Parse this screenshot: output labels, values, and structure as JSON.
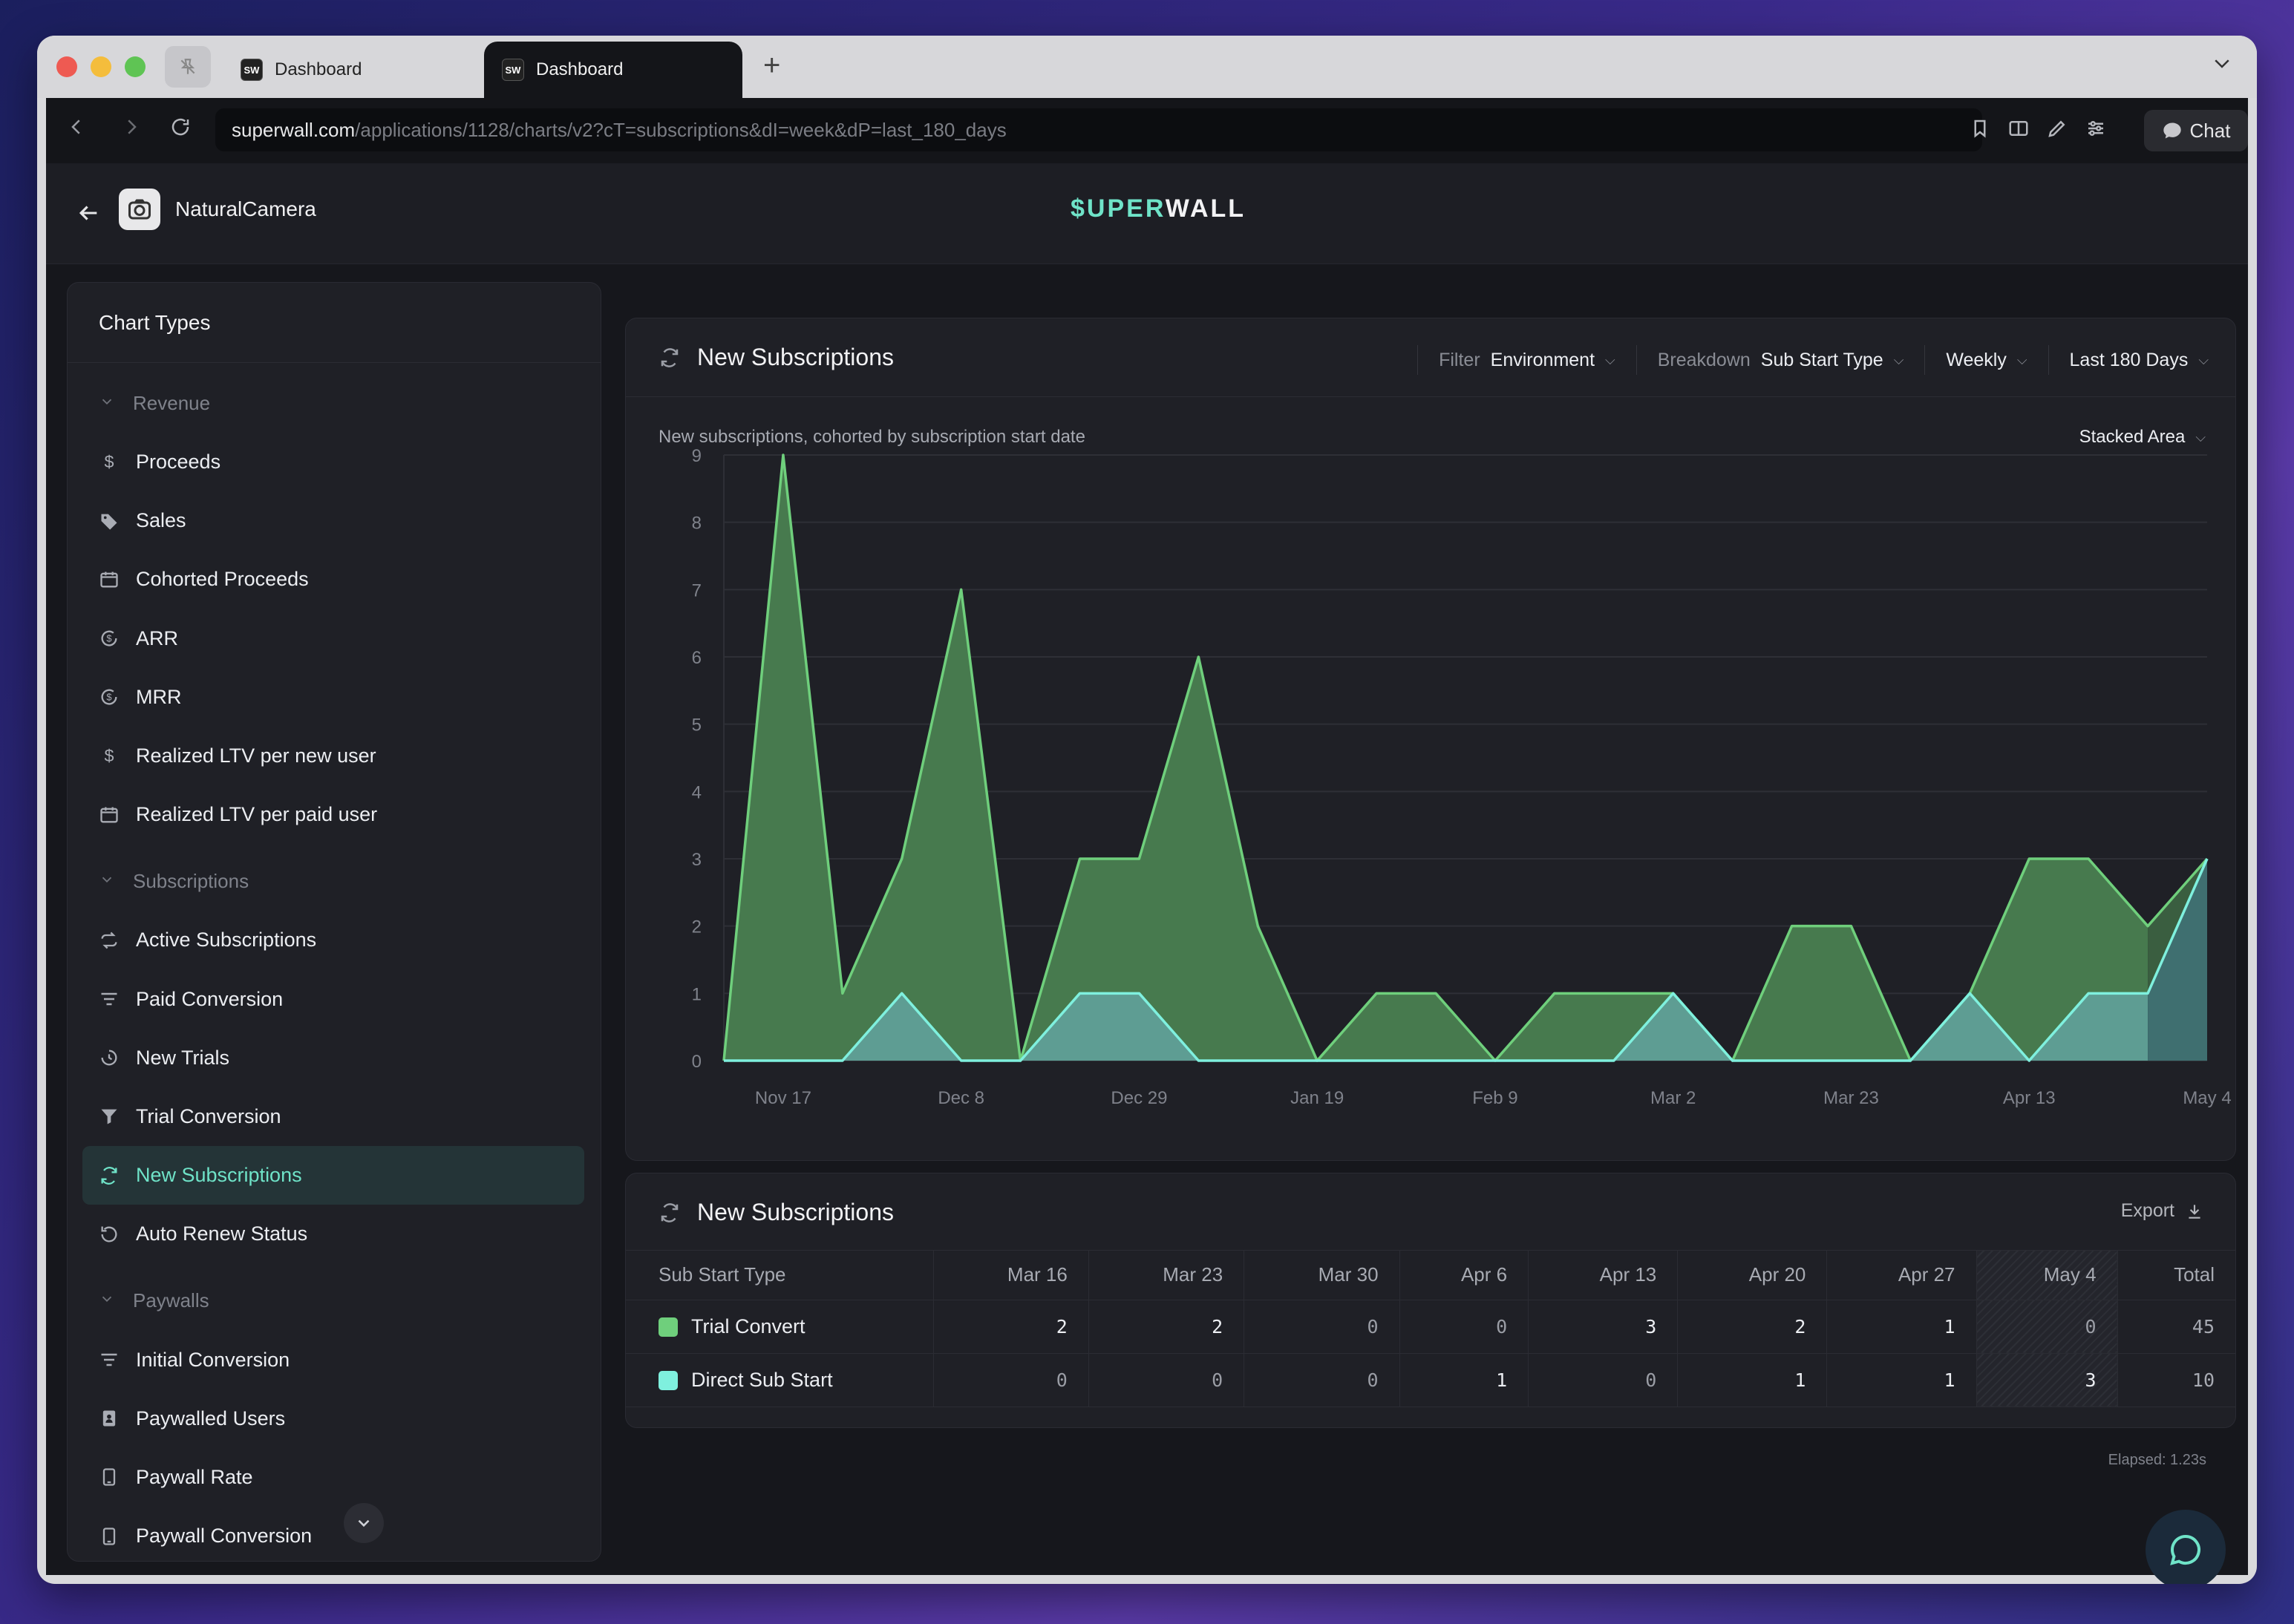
{
  "browser": {
    "tabs": [
      {
        "favicon": "SW",
        "title": "Dashboard"
      },
      {
        "favicon": "SW",
        "title": "Dashboard"
      }
    ],
    "url_host": "superwall.com",
    "url_path": "/applications/1128/charts/v2?cT=subscriptions&dI=week&dP=last_180_days",
    "chat_label": "Chat"
  },
  "app": {
    "name": "NaturalCamera",
    "logo_prefix": "$UPER",
    "logo_suffix": "WALL"
  },
  "sidebar": {
    "title": "Chart Types",
    "sections": [
      {
        "label": "Revenue",
        "items": [
          {
            "label": "Proceeds",
            "icon": "dollar-icon"
          },
          {
            "label": "Sales",
            "icon": "tag-icon"
          },
          {
            "label": "Cohorted Proceeds",
            "icon": "calendar-icon"
          },
          {
            "label": "ARR",
            "icon": "recurring-dollar-icon"
          },
          {
            "label": "MRR",
            "icon": "recurring-dollar-icon"
          },
          {
            "label": "Realized LTV per new user",
            "icon": "dollar-icon"
          },
          {
            "label": "Realized LTV per paid user",
            "icon": "calendar-icon"
          }
        ]
      },
      {
        "label": "Subscriptions",
        "items": [
          {
            "label": "Active Subscriptions",
            "icon": "repeat-icon"
          },
          {
            "label": "Paid Conversion",
            "icon": "filter-lines-icon"
          },
          {
            "label": "New Trials",
            "icon": "timer-icon"
          },
          {
            "label": "Trial Conversion",
            "icon": "funnel-icon"
          },
          {
            "label": "New Subscriptions",
            "icon": "refresh-icon",
            "active": true
          },
          {
            "label": "Auto Renew Status",
            "icon": "history-icon"
          }
        ]
      },
      {
        "label": "Paywalls",
        "items": [
          {
            "label": "Initial Conversion",
            "icon": "filter-lines-icon"
          },
          {
            "label": "Paywalled Users",
            "icon": "user-badge-icon"
          },
          {
            "label": "Paywall Rate",
            "icon": "phone-icon"
          },
          {
            "label": "Paywall Conversion",
            "icon": "phone-icon"
          }
        ]
      }
    ]
  },
  "chart_card": {
    "title": "New Subscriptions",
    "filter_label": "Filter",
    "filter_value": "Environment",
    "breakdown_label": "Breakdown",
    "breakdown_value": "Sub Start Type",
    "interval": "Weekly",
    "period": "Last 180 Days",
    "subtitle": "New subscriptions, cohorted by subscription start date",
    "chart_type": "Stacked Area"
  },
  "chart_data": {
    "type": "area",
    "stacked": true,
    "x": [
      "Nov 10",
      "Nov 17",
      "Nov 24",
      "Dec 1",
      "Dec 8",
      "Dec 15",
      "Dec 22",
      "Dec 29",
      "Jan 5",
      "Jan 12",
      "Jan 19",
      "Jan 26",
      "Feb 2",
      "Feb 9",
      "Feb 16",
      "Feb 23",
      "Mar 2",
      "Mar 9",
      "Mar 16",
      "Mar 23",
      "Mar 30",
      "Apr 6",
      "Apr 13",
      "Apr 20",
      "Apr 27",
      "May 4"
    ],
    "x_tick_labels": [
      "Nov 17",
      "Dec 8",
      "Dec 29",
      "Jan 19",
      "Feb 9",
      "Mar 2",
      "Mar 23",
      "Apr 13",
      "May 4"
    ],
    "series": [
      {
        "name": "Trial Convert",
        "color": "#6fcf7c",
        "fill": "#477a4e",
        "values": [
          0,
          9,
          1,
          2,
          7,
          0,
          2,
          2,
          6,
          2,
          0,
          1,
          1,
          0,
          1,
          1,
          0,
          0,
          2,
          2,
          0,
          0,
          3,
          2,
          1,
          0
        ]
      },
      {
        "name": "Direct Sub Start",
        "color": "#7ff0de",
        "fill": "#5e9d93",
        "values": [
          0,
          0,
          0,
          1,
          0,
          0,
          1,
          1,
          0,
          0,
          0,
          0,
          0,
          0,
          0,
          0,
          1,
          0,
          0,
          0,
          0,
          1,
          0,
          1,
          1,
          3
        ]
      }
    ],
    "partial_period_start_index": 24,
    "ylim": [
      0,
      9
    ],
    "yticks": [
      0,
      1,
      2,
      3,
      4,
      5,
      6,
      7,
      8,
      9
    ],
    "grid": true
  },
  "table_card": {
    "title": "New Subscriptions",
    "export_label": "Export",
    "first_col_header": "Sub Start Type",
    "columns": [
      "Mar 16",
      "Mar 23",
      "Mar 30",
      "Apr 6",
      "Apr 13",
      "Apr 20",
      "Apr 27",
      "May 4",
      "Total"
    ],
    "rows": [
      {
        "name": "Trial Convert",
        "color": "#6fcf7c",
        "values": [
          "2",
          "2",
          "0",
          "0",
          "3",
          "2",
          "1",
          "0",
          "45"
        ]
      },
      {
        "name": "Direct Sub Start",
        "color": "#7ff0de",
        "values": [
          "0",
          "0",
          "0",
          "1",
          "0",
          "1",
          "1",
          "3",
          "10"
        ]
      }
    ]
  },
  "footer": {
    "elapsed": "Elapsed: 1.23s"
  }
}
